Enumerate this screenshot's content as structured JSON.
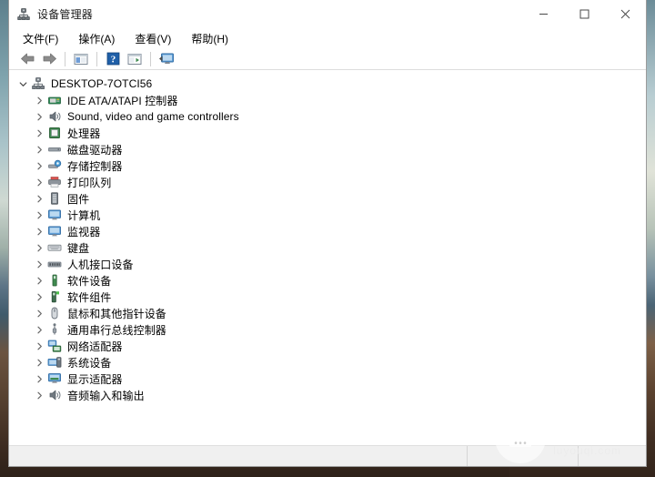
{
  "window": {
    "title": "设备管理器",
    "app_icon": "device-manager-icon",
    "controls": {
      "minimize": "最小化",
      "maximize": "最大化",
      "close": "关闭"
    }
  },
  "menubar": {
    "items": [
      {
        "label": "文件(F)",
        "name": "menu-file"
      },
      {
        "label": "操作(A)",
        "name": "menu-action"
      },
      {
        "label": "查看(V)",
        "name": "menu-view"
      },
      {
        "label": "帮助(H)",
        "name": "menu-help"
      }
    ]
  },
  "toolbar": {
    "buttons": [
      {
        "icon": "back-arrow-icon",
        "tip": "后退"
      },
      {
        "icon": "forward-arrow-icon",
        "tip": "前进"
      },
      {
        "icon": "show-hide-console-tree-icon",
        "tip": "显示/隐藏控制台树"
      },
      {
        "icon": "help-question-icon",
        "tip": "帮助"
      },
      {
        "icon": "properties-icon",
        "tip": "属性"
      },
      {
        "icon": "scan-hardware-changes-icon",
        "tip": "扫描检测硬件改动"
      }
    ]
  },
  "tree": {
    "root": {
      "label": "DESKTOP-7OTCI56",
      "icon": "computer-tree-icon",
      "expanded": true,
      "chevron": "chevron-down-icon"
    },
    "children": [
      {
        "label": "IDE ATA/ATAPI 控制器",
        "icon": "ide-controller-icon",
        "expanded": false
      },
      {
        "label": "Sound, video and game controllers",
        "icon": "speaker-icon",
        "expanded": false
      },
      {
        "label": "处理器",
        "icon": "processor-icon",
        "expanded": false
      },
      {
        "label": "磁盘驱动器",
        "icon": "disk-drive-icon",
        "expanded": false
      },
      {
        "label": "存储控制器",
        "icon": "storage-controller-icon",
        "expanded": false
      },
      {
        "label": "打印队列",
        "icon": "printer-icon",
        "expanded": false
      },
      {
        "label": "固件",
        "icon": "firmware-icon",
        "expanded": false
      },
      {
        "label": "计算机",
        "icon": "monitor-icon",
        "expanded": false
      },
      {
        "label": "监视器",
        "icon": "monitor-icon",
        "expanded": false
      },
      {
        "label": "键盘",
        "icon": "keyboard-icon",
        "expanded": false
      },
      {
        "label": "人机接口设备",
        "icon": "hid-icon",
        "expanded": false
      },
      {
        "label": "软件设备",
        "icon": "software-device-icon",
        "expanded": false
      },
      {
        "label": "软件组件",
        "icon": "software-component-icon",
        "expanded": false
      },
      {
        "label": "鼠标和其他指针设备",
        "icon": "mouse-icon",
        "expanded": false
      },
      {
        "label": "通用串行总线控制器",
        "icon": "usb-icon",
        "expanded": false
      },
      {
        "label": "网络适配器",
        "icon": "network-adapter-icon",
        "expanded": false
      },
      {
        "label": "系统设备",
        "icon": "system-device-icon",
        "expanded": false
      },
      {
        "label": "显示适配器",
        "icon": "display-adapter-icon",
        "expanded": false
      },
      {
        "label": "音频输入和输出",
        "icon": "audio-io-icon",
        "expanded": false
      }
    ]
  },
  "statusbar": {
    "pane1": "",
    "pane2": "",
    "pane3": ""
  },
  "watermark": {
    "cn": "路由器",
    "en": "luyouqi.com",
    "icon": "router-icon"
  },
  "colors": {
    "accent_blue": "#3a8fd4",
    "icon_green": "#4a9c5e",
    "window_border": "#9b9b9b",
    "statusbar_bg": "#f0f0f0",
    "close_hover": "#e81123"
  }
}
